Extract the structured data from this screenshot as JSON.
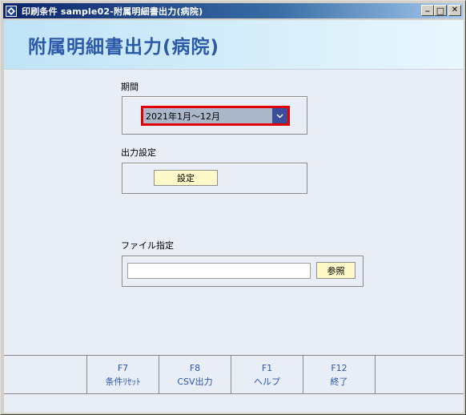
{
  "window": {
    "title": "印刷条件 sample02-附属明細書出力(病院)",
    "minimize_glyph": "_",
    "maximize_glyph": "□",
    "close_glyph": "✕"
  },
  "header": {
    "title": "附属明細書出力(病院)"
  },
  "period": {
    "label": "期間",
    "selected_value": "2021年1月～12月"
  },
  "output_settings": {
    "label": "出力設定",
    "button_label": "設定"
  },
  "file": {
    "label": "ファイル指定",
    "path_value": "",
    "browse_label": "参照"
  },
  "function_keys": [
    {
      "key": "",
      "label": ""
    },
    {
      "key": "F7",
      "label": "条件ﾘｾｯﾄ"
    },
    {
      "key": "F8",
      "label": "CSV出力"
    },
    {
      "key": "F1",
      "label": "ヘルプ"
    },
    {
      "key": "F12",
      "label": "終了"
    },
    {
      "key": "",
      "label": ""
    }
  ],
  "colors": {
    "header_title": "#2b5aa8",
    "fkey_text": "#2a57b0",
    "select_highlight": "#e00000",
    "select_arrow_bg": "#3b4e9c",
    "button_bg": "#fff8c8"
  }
}
